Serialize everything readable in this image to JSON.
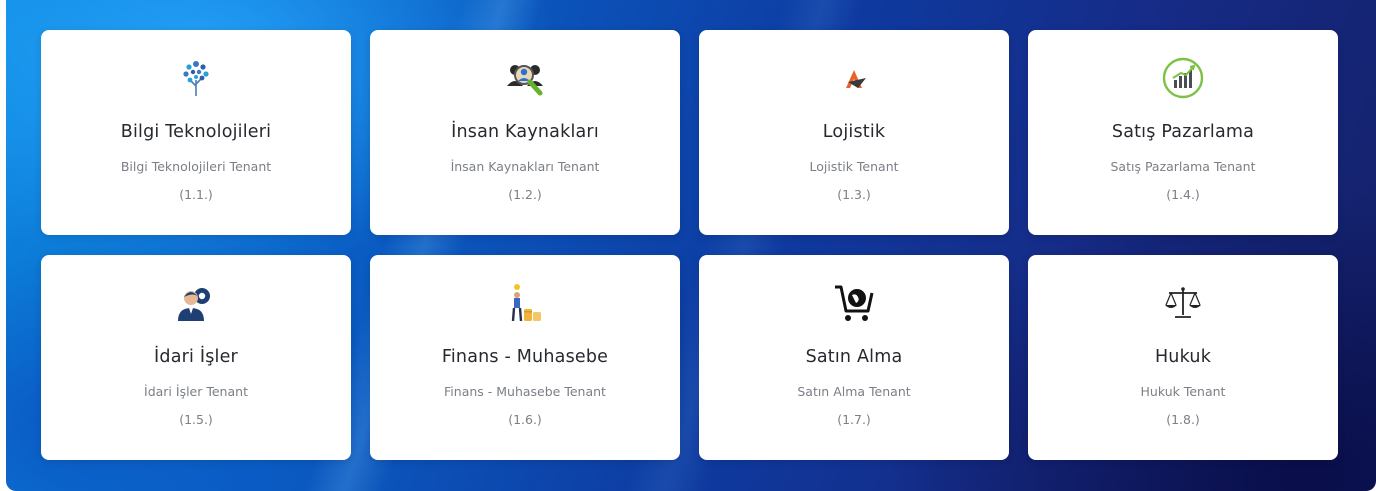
{
  "colors": {
    "card_background": "#ffffff",
    "title_text": "#26292e",
    "muted_text": "#7b7f86",
    "background_light": "#0d88e0",
    "background_dark": "#141f66"
  },
  "tenants": [
    {
      "title": "Bilgi Teknolojileri",
      "subtitle": "Bilgi Teknolojileri Tenant",
      "code": "(1.1.)",
      "icon": "tech-tree-icon"
    },
    {
      "title": "İnsan Kaynakları",
      "subtitle": "İnsan Kaynakları Tenant",
      "code": "(1.2.)",
      "icon": "people-search-icon"
    },
    {
      "title": "Lojistik",
      "subtitle": "Lojistik Tenant",
      "code": "(1.3.)",
      "icon": "logistics-logo-icon"
    },
    {
      "title": "Satış Pazarlama",
      "subtitle": "Satış Pazarlama Tenant",
      "code": "(1.4.)",
      "icon": "sales-chart-icon"
    },
    {
      "title": "İdari İşler",
      "subtitle": "İdari İşler Tenant",
      "code": "(1.5.)",
      "icon": "admin-person-gear-icon"
    },
    {
      "title": "Finans - Muhasebe",
      "subtitle": "Finans - Muhasebe Tenant",
      "code": "(1.6.)",
      "icon": "finance-coins-icon"
    },
    {
      "title": "Satın Alma",
      "subtitle": "Satın Alma Tenant",
      "code": "(1.7.)",
      "icon": "shopping-cart-globe-icon"
    },
    {
      "title": "Hukuk",
      "subtitle": "Hukuk Tenant",
      "code": "(1.8.)",
      "icon": "scales-of-justice-icon"
    }
  ]
}
